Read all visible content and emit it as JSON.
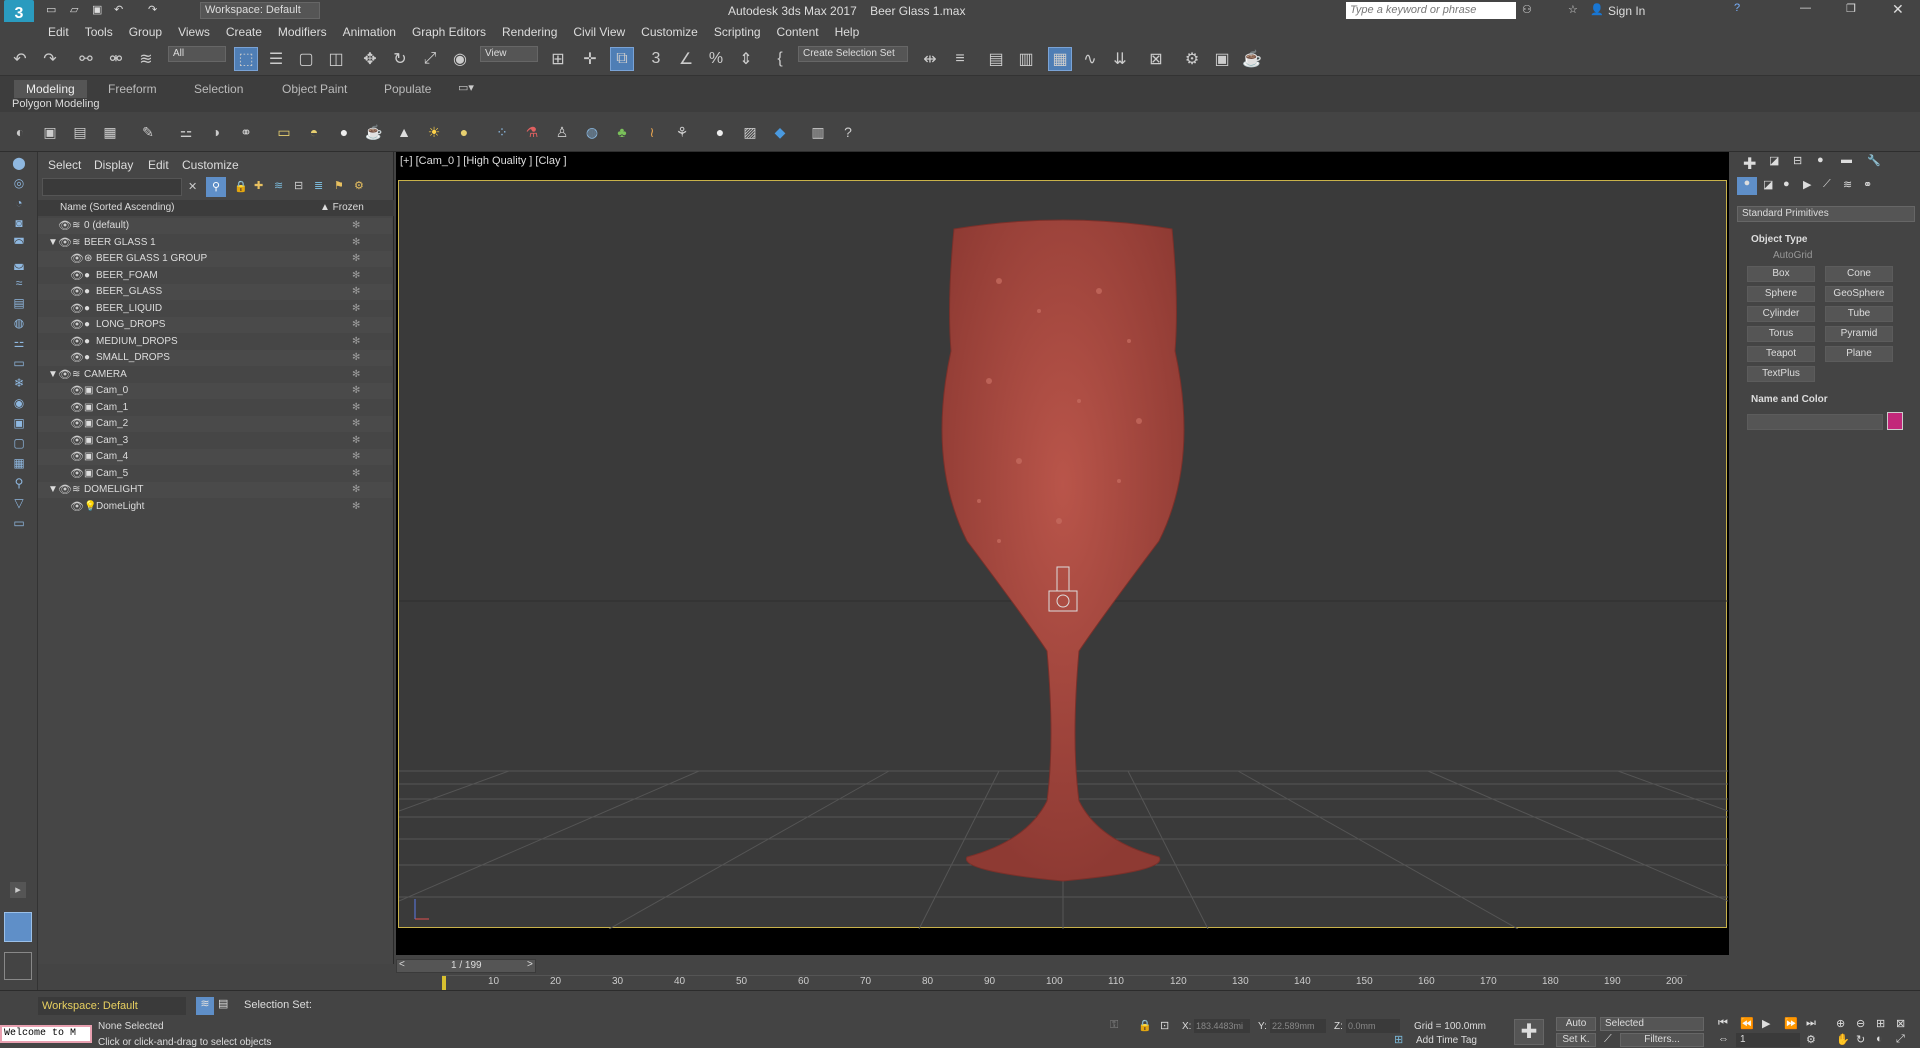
{
  "title": {
    "app": "Autodesk 3ds Max 2017",
    "file": "Beer Glass 1.max",
    "workspace": "Workspace: Default",
    "search_placeholder": "Type a keyword or phrase",
    "sign_in": "Sign In"
  },
  "menu": [
    "Edit",
    "Tools",
    "Group",
    "Views",
    "Create",
    "Modifiers",
    "Animation",
    "Graph Editors",
    "Rendering",
    "Civil View",
    "Customize",
    "Scripting",
    "Content",
    "Help"
  ],
  "toolbar": {
    "filter": "All",
    "refcoord": "View",
    "selection_set": "Create Selection Set"
  },
  "ribbon": {
    "tabs": [
      "Modeling",
      "Freeform",
      "Selection",
      "Object Paint",
      "Populate"
    ],
    "sub": "Polygon Modeling"
  },
  "explorer": {
    "menu": [
      "Select",
      "Display",
      "Edit",
      "Customize"
    ],
    "col_name": "Name (Sorted Ascending)",
    "col_frozen": "▲ Frozen",
    "rows": [
      {
        "label": "0 (default)",
        "depth": 0,
        "icon": "layer"
      },
      {
        "label": "BEER GLASS 1",
        "depth": 0,
        "icon": "layer"
      },
      {
        "label": "BEER GLASS 1 GROUP",
        "depth": 1,
        "icon": "group"
      },
      {
        "label": "BEER_FOAM",
        "depth": 1,
        "icon": "sphere"
      },
      {
        "label": "BEER_GLASS",
        "depth": 1,
        "icon": "sphere"
      },
      {
        "label": "BEER_LIQUID",
        "depth": 1,
        "icon": "sphere"
      },
      {
        "label": "LONG_DROPS",
        "depth": 1,
        "icon": "sphere"
      },
      {
        "label": "MEDIUM_DROPS",
        "depth": 1,
        "icon": "sphere"
      },
      {
        "label": "SMALL_DROPS",
        "depth": 1,
        "icon": "sphere"
      },
      {
        "label": "CAMERA",
        "depth": 0,
        "icon": "layer"
      },
      {
        "label": "Cam_0",
        "depth": 1,
        "icon": "camera"
      },
      {
        "label": "Cam_1",
        "depth": 1,
        "icon": "camera"
      },
      {
        "label": "Cam_2",
        "depth": 1,
        "icon": "camera"
      },
      {
        "label": "Cam_3",
        "depth": 1,
        "icon": "camera"
      },
      {
        "label": "Cam_4",
        "depth": 1,
        "icon": "camera"
      },
      {
        "label": "Cam_5",
        "depth": 1,
        "icon": "camera"
      },
      {
        "label": "DOMELIGHT",
        "depth": 0,
        "icon": "layer"
      },
      {
        "label": "DomeLight",
        "depth": 1,
        "icon": "light"
      }
    ]
  },
  "viewport": {
    "label": "[+] [Cam_0 ] [High Quality ] [Clay ]"
  },
  "cmd": {
    "dropdown": "Standard Primitives",
    "object_type": "Object Type",
    "autogrid": "AutoGrid",
    "buttons": [
      "Box",
      "Cone",
      "Sphere",
      "GeoSphere",
      "Cylinder",
      "Tube",
      "Torus",
      "Pyramid",
      "Teapot",
      "Plane",
      "TextPlus"
    ],
    "name_color": "Name and Color",
    "color": "#c2287a"
  },
  "time": {
    "frame": "1 / 199",
    "ticks": [
      "10",
      "20",
      "30",
      "40",
      "50",
      "60",
      "70",
      "80",
      "90",
      "100",
      "110",
      "120",
      "130",
      "140",
      "150",
      "160",
      "170",
      "180",
      "190",
      "200"
    ]
  },
  "status": {
    "workspace": "Workspace: Default",
    "selection_set": "Selection Set:",
    "maxscript": "Welcome to M",
    "none_selected": "None Selected",
    "prompt": "Click or click-and-drag to select objects",
    "x": "183.4483mi",
    "y": "22.589mm",
    "z": "0.0mm",
    "grid": "Grid = 100.0mm",
    "add_time_tag": "Add Time Tag",
    "auto": "Auto",
    "selected": "Selected",
    "setk": "Set K.",
    "filters": "Filters...",
    "frame": "1"
  }
}
